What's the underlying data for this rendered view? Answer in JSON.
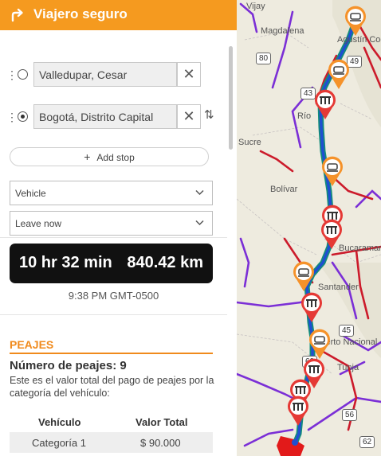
{
  "app": {
    "title": "Viajero seguro",
    "header_icon": "turn-right-arrow-icon",
    "accent": "#f59a1f"
  },
  "stops": [
    {
      "value": "Valledupar, Cesar",
      "selected": false
    },
    {
      "value": "Bogotá, Distrito Capital",
      "selected": true
    }
  ],
  "controls": {
    "clear_glyph": "✕",
    "swap_glyph": "⇅",
    "drag_glyph": "⋮",
    "add_stop_label": "Add stop",
    "add_stop_glyph": "+",
    "vehicle_select": "Vehicle",
    "departure_select": "Leave now",
    "chevron_glyph": "⌄"
  },
  "route": {
    "duration": "10 hr 32 min",
    "distance": "840.42 km",
    "arrival": "9:38 PM GMT-0500"
  },
  "peajes": {
    "title": "PEAJES",
    "count_label": "Número de peajes: 9",
    "description": "Este es el valor total del pago de peajes por la categoría del vehículo:",
    "table": {
      "headers": [
        "Vehículo",
        "Valor Total"
      ],
      "rows": [
        {
          "vehicle": "Categoría 1",
          "total": "$ 90.000"
        }
      ]
    },
    "accent": "#f08a1c"
  },
  "map": {
    "labels": [
      "Vijay",
      "Magdalena",
      "Agustín Codazzi",
      "Río",
      "Sucre",
      "Bolívar",
      "Bucaramanga",
      "Santander",
      "Puerto Nacional",
      "Tunja"
    ],
    "road_shields": [
      "80",
      "49",
      "43",
      "60",
      "45",
      "56",
      "62"
    ],
    "colors": {
      "route": "#1f4fd1",
      "route_casing": "#138c7a",
      "primary_roads": "#cc1b2b",
      "secondary_roads": "#7b2fd6",
      "toll_marker": "#e53935",
      "service_marker": "#f5922a"
    },
    "toll_markers": 7,
    "service_markers": 5
  }
}
